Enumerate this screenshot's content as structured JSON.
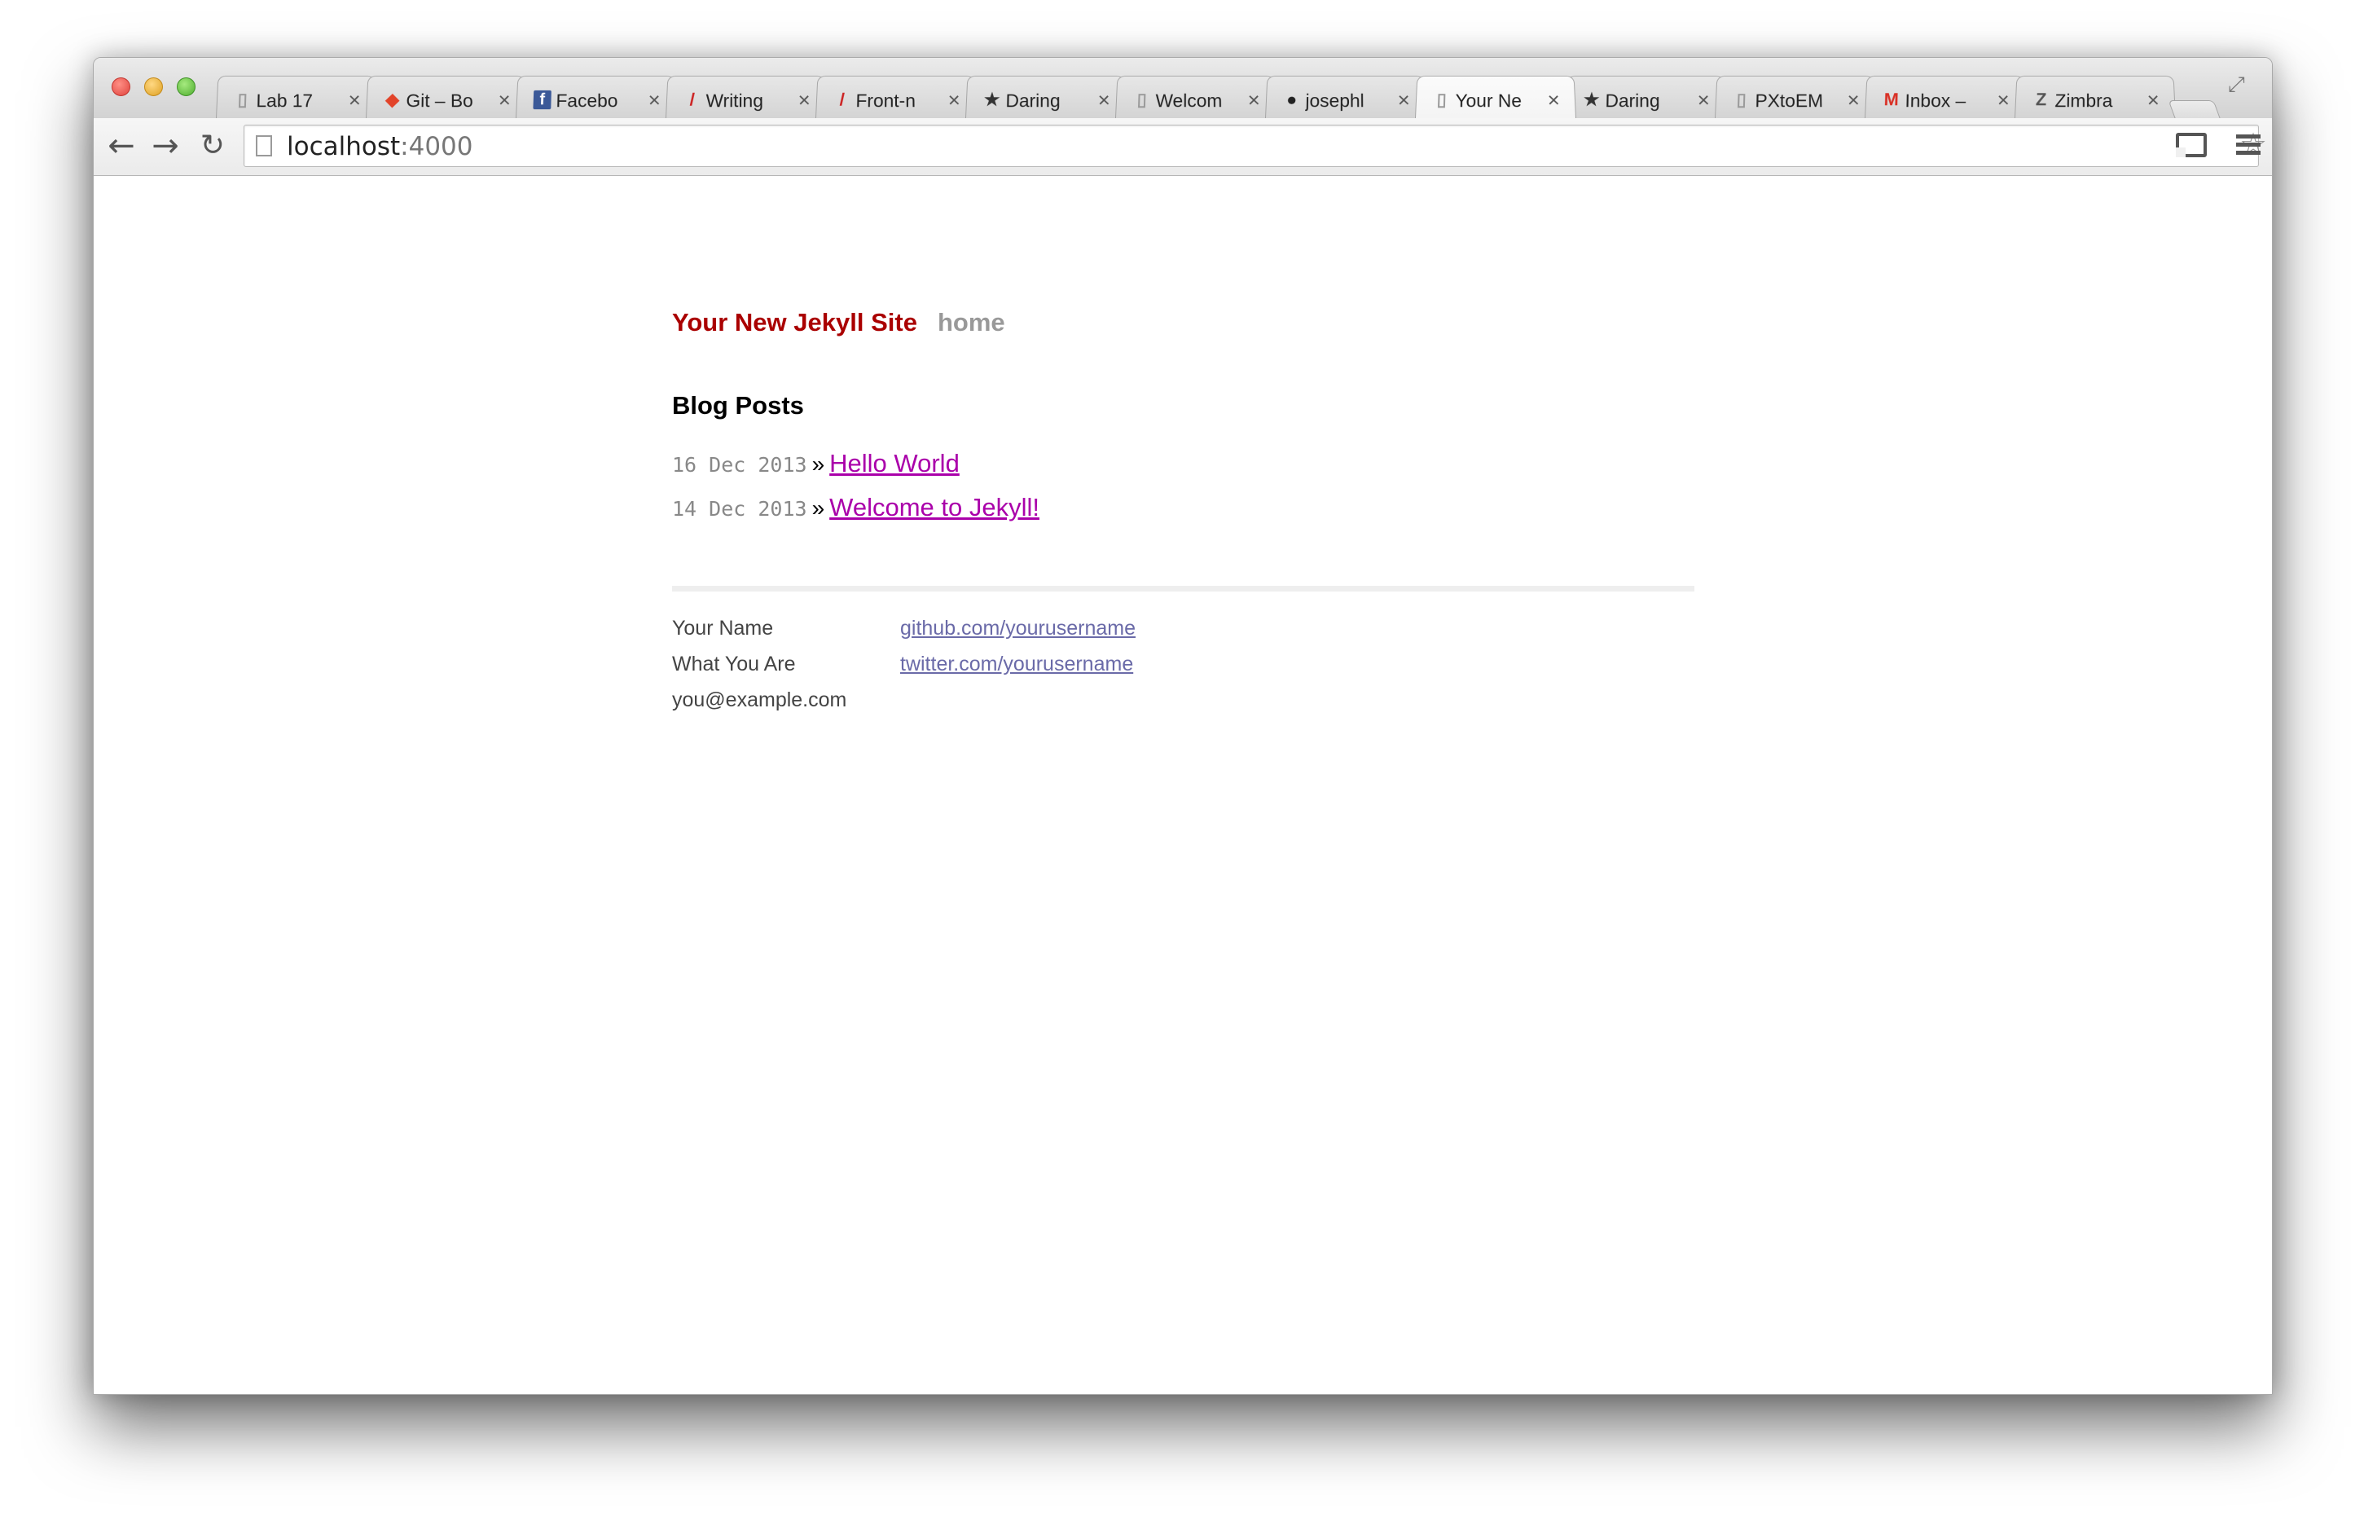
{
  "browser": {
    "tabs": [
      {
        "title": "Lab 17",
        "icon": "page-icon",
        "close": "×"
      },
      {
        "title": "Git – Bo",
        "icon": "git-icon",
        "close": "×"
      },
      {
        "title": "Facebo",
        "icon": "facebook-icon",
        "close": "×"
      },
      {
        "title": "Writing",
        "icon": "quill-icon",
        "close": "×"
      },
      {
        "title": "Front-n",
        "icon": "quill-icon",
        "close": "×"
      },
      {
        "title": "Daring",
        "icon": "star-circle-icon",
        "close": "×"
      },
      {
        "title": "Welcom",
        "icon": "page-icon",
        "close": "×"
      },
      {
        "title": "josephl",
        "icon": "github-icon",
        "close": "×"
      },
      {
        "title": "Your Ne",
        "icon": "page-icon",
        "close": "×",
        "active": true
      },
      {
        "title": "Daring",
        "icon": "star-circle-icon",
        "close": "×"
      },
      {
        "title": "PXtoEM",
        "icon": "page-icon",
        "close": "×"
      },
      {
        "title": "Inbox –",
        "icon": "gmail-icon",
        "close": "×"
      },
      {
        "title": "Zimbra",
        "icon": "zimbra-icon",
        "close": "×"
      }
    ],
    "url_host": "localhost",
    "url_port": ":4000",
    "glyphs": {
      "back": "←",
      "forward": "→",
      "reload": "↻",
      "star": "☆",
      "fullscreen": "⤢"
    }
  },
  "page": {
    "site_title": "Your New Jekyll Site",
    "nav_home": "home",
    "section_title": "Blog Posts",
    "posts": [
      {
        "date": "16 Dec 2013",
        "sep": "»",
        "title": "Hello World"
      },
      {
        "date": "14 Dec 2013",
        "sep": "»",
        "title": "Welcome to Jekyll!"
      }
    ],
    "footer": {
      "name": "Your Name",
      "role": "What You Are",
      "email": "you@example.com",
      "github": "github.com/yourusername",
      "twitter": "twitter.com/yourusername"
    }
  },
  "colors": {
    "site_title": "#aa0000",
    "nav_link": "#999999",
    "post_link": "#aa00aa",
    "footer_link": "#6a6aa8"
  }
}
